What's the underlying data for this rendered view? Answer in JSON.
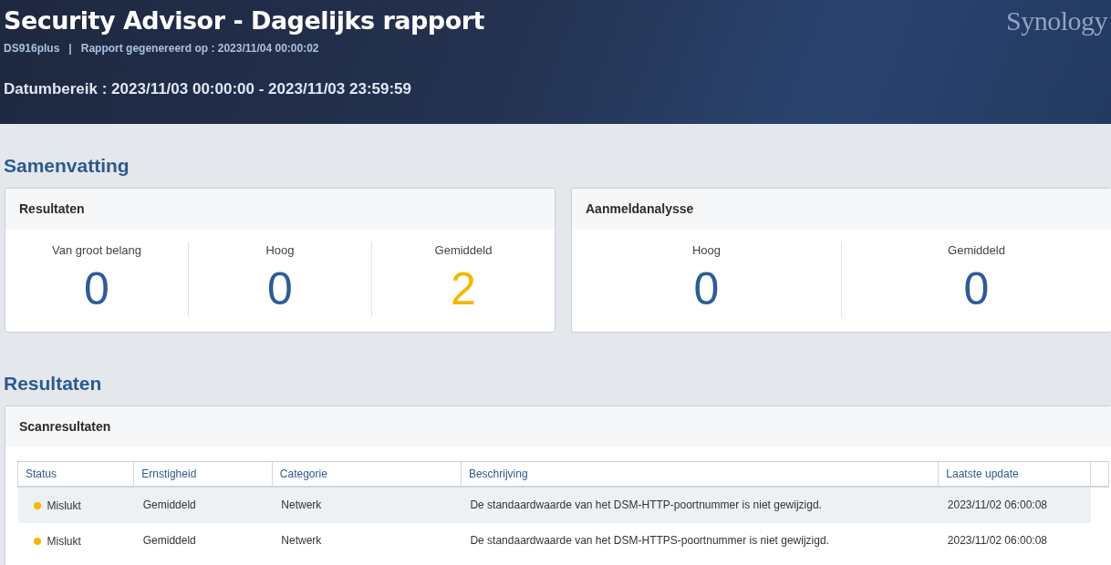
{
  "header": {
    "title": "Security Advisor - Dagelijks rapport",
    "device": "DS916plus",
    "separator": "|",
    "generated": "Rapport gegenereerd op : 2023/11/04 00:00:02",
    "date_range": "Datumbereik : 2023/11/03 00:00:00 - 2023/11/03 23:59:59",
    "logo": "Synology"
  },
  "summary": {
    "title": "Samenvatting",
    "cards": [
      {
        "title": "Resultaten",
        "stats": [
          {
            "label": "Van groot belang",
            "value": "0",
            "color": "#2d5d96"
          },
          {
            "label": "Hoog",
            "value": "0",
            "color": "#2d5d96"
          },
          {
            "label": "Gemiddeld",
            "value": "2",
            "color": "#f5b800"
          }
        ]
      },
      {
        "title": "Aanmeldanalysse",
        "stats": [
          {
            "label": "Hoog",
            "value": "0",
            "color": "#2d5d96"
          },
          {
            "label": "Gemiddeld",
            "value": "0",
            "color": "#2d5d96"
          }
        ]
      }
    ]
  },
  "results": {
    "title": "Resultaten",
    "card_title": "Scanresultaten",
    "table": {
      "columns": [
        "Status",
        "Ernstigheid",
        "Categorie",
        "Beschrijving",
        "Laatste update"
      ],
      "rows": [
        {
          "selected": true,
          "color": "#f5b800",
          "cells": [
            "Mislukt",
            "Gemiddeld",
            "Netwerk",
            "De standaardwaarde van het DSM-HTTP-poortnummer is niet gewijzigd.",
            "2023/11/02 06:00:08"
          ]
        },
        {
          "selected": false,
          "color": "#f5b800",
          "cells": [
            "Mislukt",
            "Gemiddeld",
            "Netwerk",
            "De standaardwaarde van het DSM-HTTPS-poortnummer is niet gewijzigd.",
            "2023/11/02 06:00:08"
          ]
        }
      ]
    }
  }
}
